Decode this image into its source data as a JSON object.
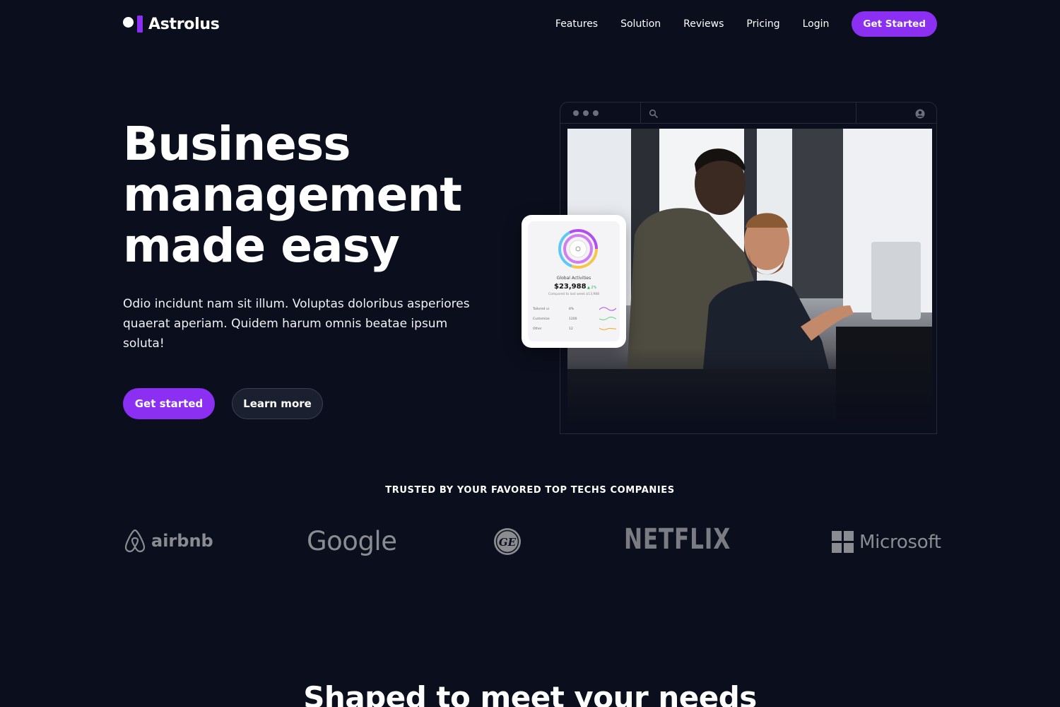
{
  "brand": {
    "name": "Astrolus",
    "accent": "#8b2ff3",
    "background": "#0b0e1c"
  },
  "nav": {
    "links": [
      "Features",
      "Solution",
      "Reviews",
      "Pricing",
      "Login"
    ],
    "cta": "Get Started"
  },
  "hero": {
    "title_lines": [
      "Business",
      "management",
      "made easy"
    ],
    "subtitle": "Odio incidunt nam sit illum. Voluptas doloribus asperiores quaerat aperiam. Quidem harum omnis beatae ipsum soluta!",
    "primary_button": "Get started",
    "secondary_button": "Learn more"
  },
  "browser_mockup": {
    "icons": [
      "search-icon",
      "user-icon"
    ]
  },
  "card": {
    "title": "Global Activities",
    "amount": "$23,988",
    "delta": "▲ 2%",
    "subtitle": "Compared to last week $13,988",
    "rows": [
      {
        "label": "Tailored ui",
        "value": "8%",
        "color": "#b04cf0"
      },
      {
        "label": "Customize",
        "value": "1200",
        "color": "#5ad67d"
      },
      {
        "label": "Other",
        "value": "12",
        "color": "#f5a623"
      }
    ]
  },
  "trusted": {
    "heading": "TRUSTED BY YOUR FAVORED TOP TECHS COMPANIES",
    "logos": [
      "airbnb",
      "Google",
      "GE",
      "NETFLIX",
      "Microsoft"
    ]
  },
  "next_section": {
    "title": "Shaped to meet your needs"
  }
}
